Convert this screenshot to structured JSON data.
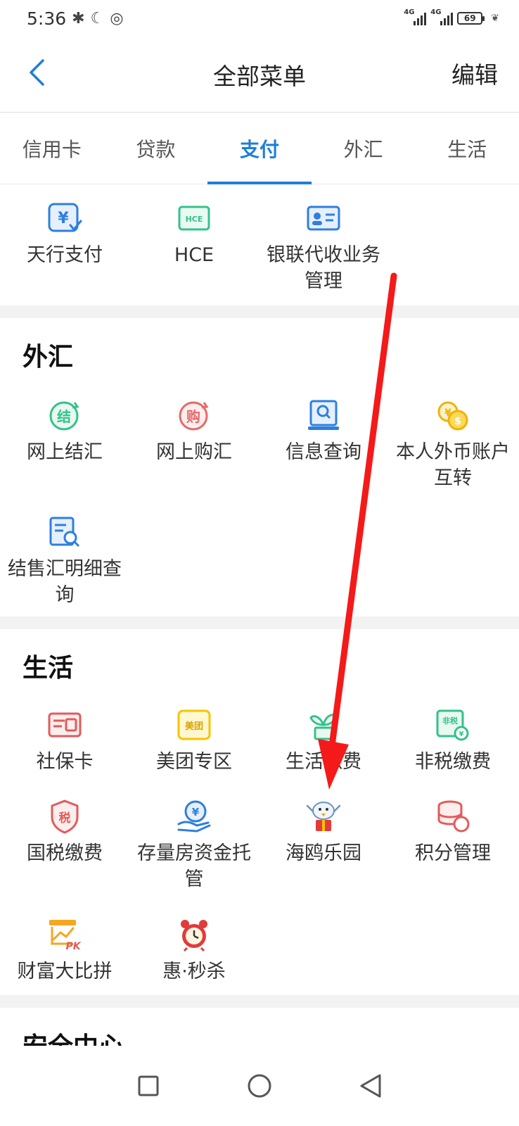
{
  "status_bar": {
    "time": "5:36",
    "network_label": "4G",
    "battery": "69"
  },
  "header": {
    "title": "全部菜单",
    "edit_label": "编辑"
  },
  "tabs": [
    {
      "label": "信用卡"
    },
    {
      "label": "贷款"
    },
    {
      "label": "支付"
    },
    {
      "label": "外汇"
    },
    {
      "label": "生活"
    }
  ],
  "payment": {
    "items": [
      {
        "label": "天行支付",
        "icon": "yuan-check-icon"
      },
      {
        "label": "HCE",
        "icon": "hce-card-icon"
      },
      {
        "label": "银联代收业务管理",
        "icon": "id-card-icon"
      }
    ]
  },
  "forex": {
    "title": "外汇",
    "items": [
      {
        "label": "网上结汇",
        "icon": "settle-icon",
        "icon_text": "结"
      },
      {
        "label": "网上购汇",
        "icon": "purchase-icon",
        "icon_text": "购"
      },
      {
        "label": "信息查询",
        "icon": "info-search-icon"
      },
      {
        "label": "本人外币账户互转",
        "icon": "currency-exchange-icon"
      },
      {
        "label": "结售汇明细查询",
        "icon": "detail-search-icon"
      }
    ]
  },
  "life": {
    "title": "生活",
    "items": [
      {
        "label": "社保卡",
        "icon": "social-card-icon"
      },
      {
        "label": "美团专区",
        "icon": "meituan-icon",
        "icon_text": "美团"
      },
      {
        "label": "生活缴费",
        "icon": "plant-icon"
      },
      {
        "label": "非税缴费",
        "icon": "non-tax-icon",
        "icon_text": "非税"
      },
      {
        "label": "国税缴费",
        "icon": "tax-shield-icon",
        "icon_text": "税"
      },
      {
        "label": "存量房资金托管",
        "icon": "hand-yuan-icon"
      },
      {
        "label": "海鸥乐园",
        "icon": "seagull-icon"
      },
      {
        "label": "积分管理",
        "icon": "coins-stack-icon"
      },
      {
        "label": "财富大比拼",
        "icon": "pk-chart-icon",
        "icon_text": "PK"
      },
      {
        "label": "惠·秒杀",
        "icon": "alarm-clock-icon"
      }
    ]
  },
  "security": {
    "title": "安全中心"
  },
  "colors": {
    "accent": "#1e7fd6",
    "arrow": "#f41a1a"
  }
}
